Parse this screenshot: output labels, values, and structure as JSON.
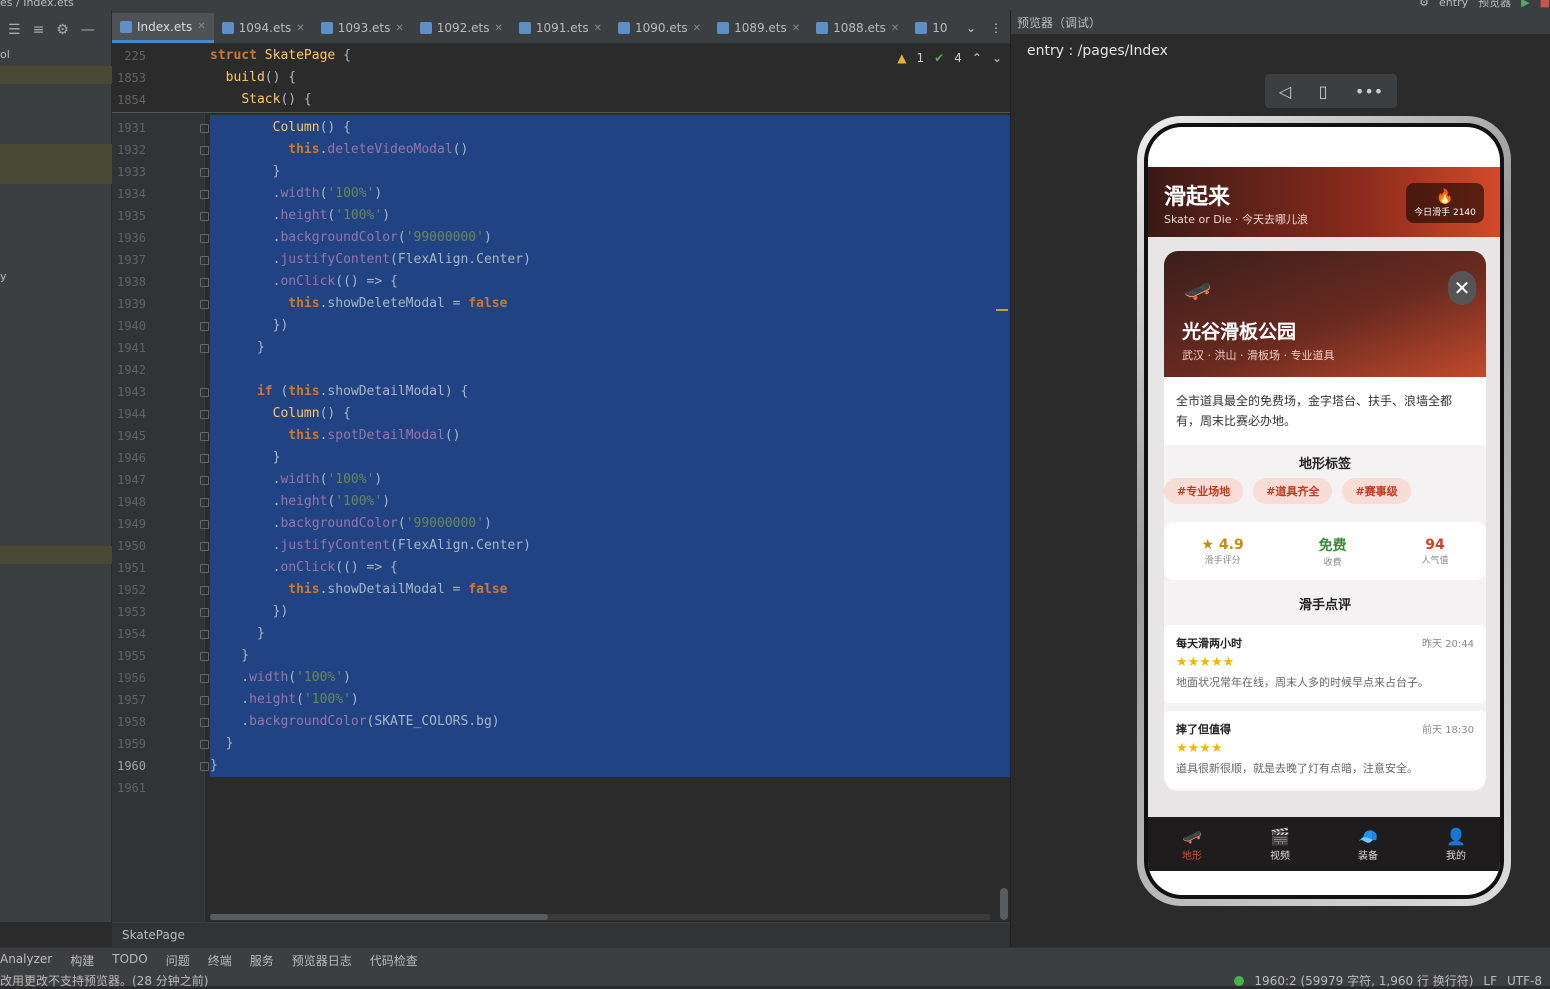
{
  "topbar": {
    "crumb": "es  /  Index.ets",
    "entry": "entry",
    "previewer": "预览器"
  },
  "left_pane": {
    "rows": [
      "ol",
      "y"
    ]
  },
  "tabs": [
    "Index.ets",
    "1094.ets",
    "1093.ets",
    "1092.ets",
    "1091.ets",
    "1090.ets",
    "1089.ets",
    "1088.ets",
    "10"
  ],
  "editor": {
    "warnings": "1",
    "checks": "4",
    "sticky": [
      {
        "n": "225",
        "code": "struct SkatePage {"
      },
      {
        "n": "1853",
        "code": "  build() {"
      },
      {
        "n": "1854",
        "code": "    Stack() {"
      }
    ],
    "lines": [
      {
        "n": "1931",
        "code": "        Column() {"
      },
      {
        "n": "1932",
        "code": "          this.deleteVideoModal()"
      },
      {
        "n": "1933",
        "code": "        }"
      },
      {
        "n": "1934",
        "code": "        .width('100%')"
      },
      {
        "n": "1935",
        "code": "        .height('100%')"
      },
      {
        "n": "1936",
        "code": "        .backgroundColor('99000000')"
      },
      {
        "n": "1937",
        "code": "        .justifyContent(FlexAlign.Center)"
      },
      {
        "n": "1938",
        "code": "        .onClick(() => {"
      },
      {
        "n": "1939",
        "code": "          this.showDeleteModal = false"
      },
      {
        "n": "1940",
        "code": "        })"
      },
      {
        "n": "1941",
        "code": "      }"
      },
      {
        "n": "1942",
        "code": ""
      },
      {
        "n": "1943",
        "code": "      if (this.showDetailModal) {"
      },
      {
        "n": "1944",
        "code": "        Column() {"
      },
      {
        "n": "1945",
        "code": "          this.spotDetailModal()"
      },
      {
        "n": "1946",
        "code": "        }"
      },
      {
        "n": "1947",
        "code": "        .width('100%')"
      },
      {
        "n": "1948",
        "code": "        .height('100%')"
      },
      {
        "n": "1949",
        "code": "        .backgroundColor('99000000')"
      },
      {
        "n": "1950",
        "code": "        .justifyContent(FlexAlign.Center)"
      },
      {
        "n": "1951",
        "code": "        .onClick(() => {"
      },
      {
        "n": "1952",
        "code": "          this.showDetailModal = false"
      },
      {
        "n": "1953",
        "code": "        })"
      },
      {
        "n": "1954",
        "code": "      }"
      },
      {
        "n": "1955",
        "code": "    }"
      },
      {
        "n": "1956",
        "code": "    .width('100%')"
      },
      {
        "n": "1957",
        "code": "    .height('100%')"
      },
      {
        "n": "1958",
        "code": "    .backgroundColor(SKATE_COLORS.bg)"
      },
      {
        "n": "1959",
        "code": "  }"
      },
      {
        "n": "1960",
        "code": "}"
      },
      {
        "n": "1961",
        "code": ""
      }
    ]
  },
  "breadcrumb": "SkatePage",
  "preview": {
    "title": "预览器（调试）",
    "route": "entry : /pages/Index",
    "app": {
      "title": "滑起来",
      "subtitle": "Skate or Die · 今天去哪儿浪",
      "hot_label": "今日滑手 2140",
      "spot_name": "光谷滑板公园",
      "spot_loc": "武汉 · 洪山 · 滑板场 · 专业道具",
      "desc": "全市道具最全的免费场，金字塔台、扶手、浪墙全都有，周末比赛必办地。",
      "tags_title": "地形标签",
      "tags": [
        "#专业场地",
        "#道具齐全",
        "#赛事级"
      ],
      "stats": [
        {
          "value": "4.9",
          "label": "滑手评分"
        },
        {
          "value": "免费",
          "label": "收费"
        },
        {
          "value": "94",
          "label": "人气值"
        }
      ],
      "reviews_title": "滑手点评",
      "reviews": [
        {
          "user": "每天滑两小时",
          "time": "昨天 20:44",
          "stars": "★★★★★",
          "text": "地面状况常年在线，周末人多的时候早点来占台子。"
        },
        {
          "user": "摔了但值得",
          "time": "前天 18:30",
          "stars": "★★★★",
          "text": "道具很新很顺，就是去晚了灯有点暗，注意安全。"
        }
      ],
      "nav": [
        "地形",
        "视频",
        "装备",
        "我的"
      ]
    }
  },
  "status": {
    "tools": [
      "Analyzer",
      "构建",
      "TODO",
      "问题",
      "终端",
      "服务",
      "预览器日志",
      "代码检查"
    ],
    "message": "改用更改不支持预览器。(28 分钟之前)",
    "position": "1960:2 (59979 字符, 1,960 行 换行符)",
    "lf": "LF",
    "enc": "UTF-8"
  }
}
